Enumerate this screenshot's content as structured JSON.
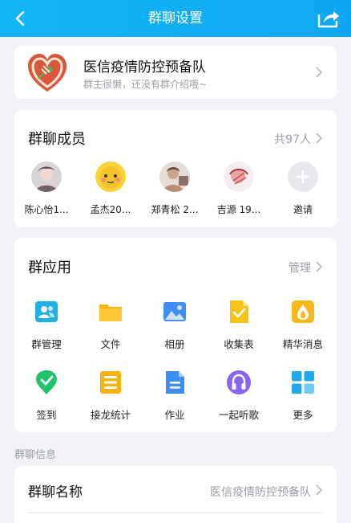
{
  "header": {
    "title": "群聊设置"
  },
  "group": {
    "name": "医信疫情防控预备队",
    "description": "群主很懒，还没有群介绍哦~"
  },
  "members": {
    "title": "群聊成员",
    "count_label": "共97人",
    "items": [
      {
        "name": "陈心怡1..."
      },
      {
        "name": "孟杰20..."
      },
      {
        "name": "郑青松 2..."
      },
      {
        "name": "吉源 19..."
      },
      {
        "name": "邀请"
      }
    ]
  },
  "apps": {
    "title": "群应用",
    "manage_label": "管理",
    "items": [
      {
        "label": "群管理",
        "icon": "group-manage-icon",
        "color": "#1fb0e6"
      },
      {
        "label": "文件",
        "icon": "folder-icon",
        "color": "#f5b50a"
      },
      {
        "label": "相册",
        "icon": "photo-album-icon",
        "color": "#3f8ef5"
      },
      {
        "label": "收集表",
        "icon": "collect-form-icon",
        "color": "#f6c316"
      },
      {
        "label": "精华消息",
        "icon": "essence-icon",
        "color": "#f7b81b"
      },
      {
        "label": "签到",
        "icon": "check-in-icon",
        "color": "#22c46b"
      },
      {
        "label": "接龙统计",
        "icon": "relay-stats-icon",
        "color": "#f4b20c"
      },
      {
        "label": "作业",
        "icon": "homework-icon",
        "color": "#3b8ff0"
      },
      {
        "label": "一起听歌",
        "icon": "listen-music-icon",
        "color": "#8b65f0"
      },
      {
        "label": "更多",
        "icon": "more-apps-icon",
        "color": "#21a8ea"
      }
    ]
  },
  "info": {
    "section_label": "群聊信息",
    "name_row": {
      "label": "群聊名称",
      "value": "医信疫情防控预备队"
    }
  }
}
